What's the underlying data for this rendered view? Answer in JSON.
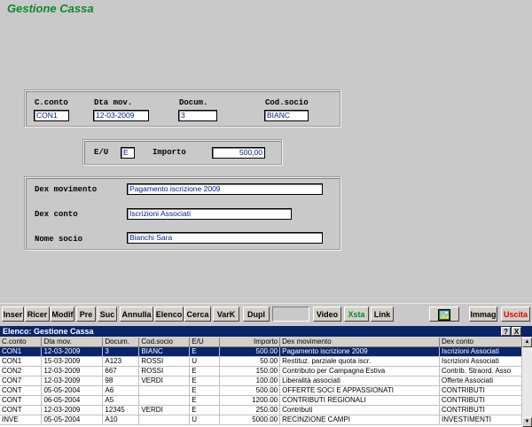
{
  "app": {
    "title": "Gestione Cassa"
  },
  "form": {
    "conto_label": "C.conto",
    "conto_value": "CON1",
    "data_label": "Dta mov.",
    "data_value": "12-03-2009",
    "docum_label": "Docum.",
    "docum_value": "3",
    "socio_label": "Cod.socio",
    "socio_value": "BIANC",
    "eu_label": "E/U",
    "eu_value": "E",
    "importo_label": "Importo",
    "importo_value": "500,00",
    "dexmov_label": "Dex movimento",
    "dexmov_value": "Pagamento iscrizione 2009",
    "dexconto_label": "Dex conto",
    "dexconto_value": "Iscrizioni Associati",
    "nome_label": "Nome socio",
    "nome_value": "Bianchi Sara"
  },
  "toolbar": {
    "inser": "Inser",
    "ricer": "Ricer",
    "modif": "Modif",
    "pre": "Pre",
    "suc": "Suc",
    "annulla": "Annulla",
    "elenco": "Elenco",
    "cerca": "Cerca",
    "vark": "VarK",
    "dupl": "Dupl",
    "video": "Video",
    "xsta": "Xsta",
    "link": "Link",
    "immag": "Immag",
    "uscita": "Uscita"
  },
  "list": {
    "title": "Elenco: Gestione Cassa",
    "help_btn": "?",
    "close_btn": "X",
    "columns": [
      "C.conto",
      "Dta mov.",
      "Docum.",
      "Cod.socio",
      "E/U",
      "Importo",
      "Dex movimento",
      "Dex conto"
    ],
    "rows": [
      [
        "CON1",
        "12-03-2009",
        "3",
        "BIANC",
        "E",
        "500.00",
        "Pagamento iscrizione 2009",
        "Iscrizioni Associati"
      ],
      [
        "CON1",
        "15-03-2009",
        "A123",
        "ROSSI",
        "U",
        "50.00",
        "Restituz. parziale quota iscr.",
        "Iscrizioni Associati"
      ],
      [
        "CON2",
        "12-03-2009",
        "667",
        "ROSSI",
        "E",
        "150.00",
        "Contributo per Campagna Estiva",
        "Contrib. Straord. Asso"
      ],
      [
        "CON7",
        "12-03-2009",
        "98",
        "VERDI",
        "E",
        "100.00",
        "Liberalità associati",
        "Offerte Associati"
      ],
      [
        "CONT",
        "05-05-2004",
        "A6",
        "",
        "E",
        "500.00",
        "OFFERTE SOCI E APPASSIONATI",
        "CONTRIBUTI"
      ],
      [
        "CONT",
        "06-05-2004",
        "A5",
        "",
        "E",
        "1200.00",
        "CONTRIBUTI REGIONALI",
        "CONTRIBUTI"
      ],
      [
        "CONT",
        "12-03-2009",
        "12345",
        "VERDI",
        "E",
        "250.00",
        "Contributi",
        "CONTRIBUTI"
      ],
      [
        "INVE",
        "05-05-2004",
        "A10",
        "",
        "U",
        "5000.00",
        "RECINZIONE CAMPI",
        "INVESTIMENTI"
      ]
    ],
    "selected_row": 0
  },
  "colors": {
    "title_green": "#0a8a2a",
    "selection_blue": "#0a246a",
    "uscita_red": "#e00000",
    "field_text": "#001a8a"
  }
}
